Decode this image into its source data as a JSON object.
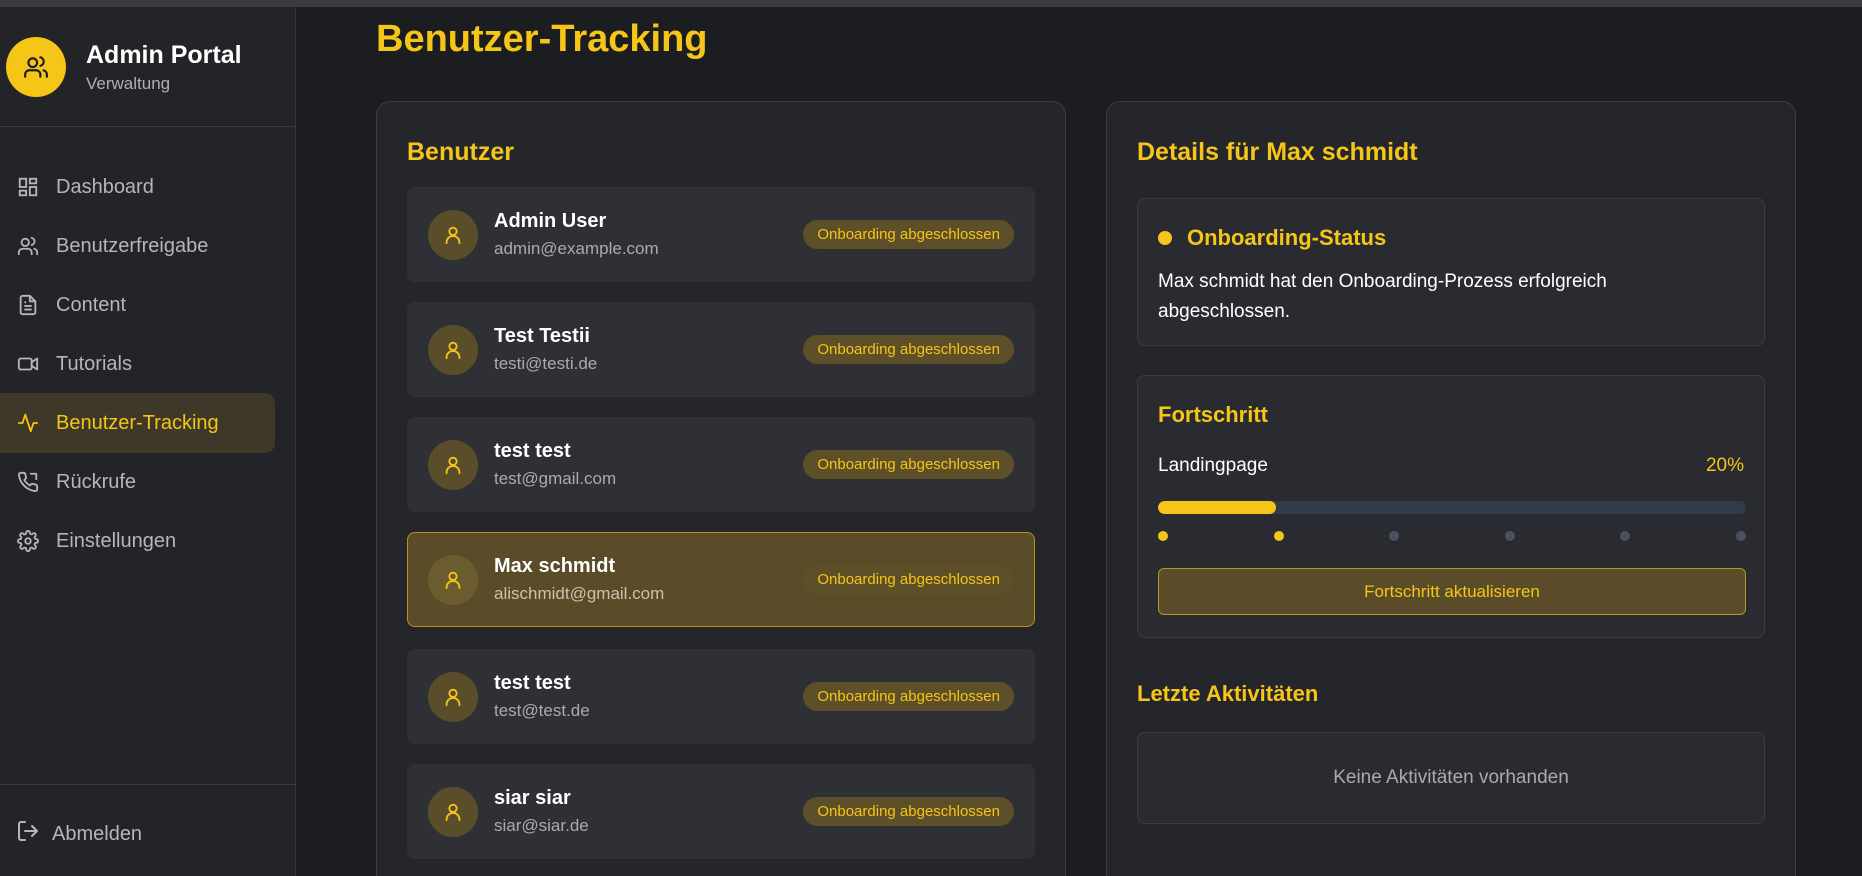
{
  "brand": {
    "title": "Admin Portal",
    "subtitle": "Verwaltung"
  },
  "nav": [
    {
      "label": "Dashboard",
      "icon": "dashboard-icon",
      "active": false
    },
    {
      "label": "Benutzerfreigabe",
      "icon": "users-icon",
      "active": false
    },
    {
      "label": "Content",
      "icon": "document-icon",
      "active": false
    },
    {
      "label": "Tutorials",
      "icon": "video-icon",
      "active": false
    },
    {
      "label": "Benutzer-Tracking",
      "icon": "activity-icon",
      "active": true
    },
    {
      "label": "Rückrufe",
      "icon": "phone-icon",
      "active": false
    },
    {
      "label": "Einstellungen",
      "icon": "gear-icon",
      "active": false
    }
  ],
  "logout": {
    "label": "Abmelden"
  },
  "page": {
    "title": "Benutzer-Tracking"
  },
  "users_card": {
    "title": "Benutzer"
  },
  "users": [
    {
      "name": "Admin User",
      "email": "admin@example.com",
      "status": "Onboarding abgeschlossen",
      "selected": false
    },
    {
      "name": "Test Testii",
      "email": "testi@testi.de",
      "status": "Onboarding abgeschlossen",
      "selected": false
    },
    {
      "name": "test test",
      "email": "test@gmail.com",
      "status": "Onboarding abgeschlossen",
      "selected": false
    },
    {
      "name": "Max schmidt",
      "email": "alischmidt@gmail.com",
      "status": "Onboarding abgeschlossen",
      "selected": true
    },
    {
      "name": "test test",
      "email": "test@test.de",
      "status": "Onboarding abgeschlossen",
      "selected": false
    },
    {
      "name": "siar siar",
      "email": "siar@siar.de",
      "status": "Onboarding abgeschlossen",
      "selected": false
    }
  ],
  "details": {
    "title": "Details für Max schmidt",
    "status_title": "Onboarding-Status",
    "status_text": "Max schmidt hat den Onboarding-Prozess erfolgreich abgeschlossen.",
    "progress_title": "Fortschritt",
    "progress_label": "Landingpage",
    "progress_percent": "20%",
    "progress_value": 0.2,
    "steps_completed": 2,
    "steps_total": 6,
    "update_button": "Fortschritt aktualisieren",
    "activity_title": "Letzte Aktivitäten",
    "activity_empty": "Keine Aktivitäten vorhanden"
  },
  "colors": {
    "accent": "#f5c518",
    "background": "#1c1d21",
    "card": "#25262b"
  }
}
